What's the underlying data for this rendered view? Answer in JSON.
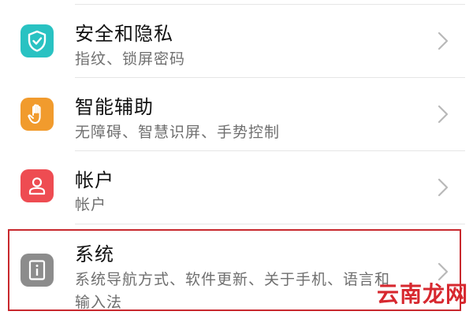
{
  "settings": {
    "items": [
      {
        "title": "安全和隐私",
        "subtitle": "指纹、锁屏密码",
        "icon": "shield-check-icon",
        "icon_color": "#29c2c2"
      },
      {
        "title": "智能辅助",
        "subtitle": "无障碍、智慧识屏、手势控制",
        "icon": "hand-icon",
        "icon_color": "#f19b2d"
      },
      {
        "title": "帐户",
        "subtitle": "帐户",
        "icon": "person-icon",
        "icon_color": "#ee4c52"
      },
      {
        "title": "系统",
        "subtitle_line1": "系统导航方式、软件更新、关于手机、语言和",
        "subtitle_line2": "输入法",
        "icon": "system-info-icon",
        "icon_color": "#8c8c8c"
      }
    ]
  },
  "highlight": {
    "color": "#c8282d"
  },
  "watermark": {
    "text": "云南龙网",
    "color": "#d7282f"
  }
}
